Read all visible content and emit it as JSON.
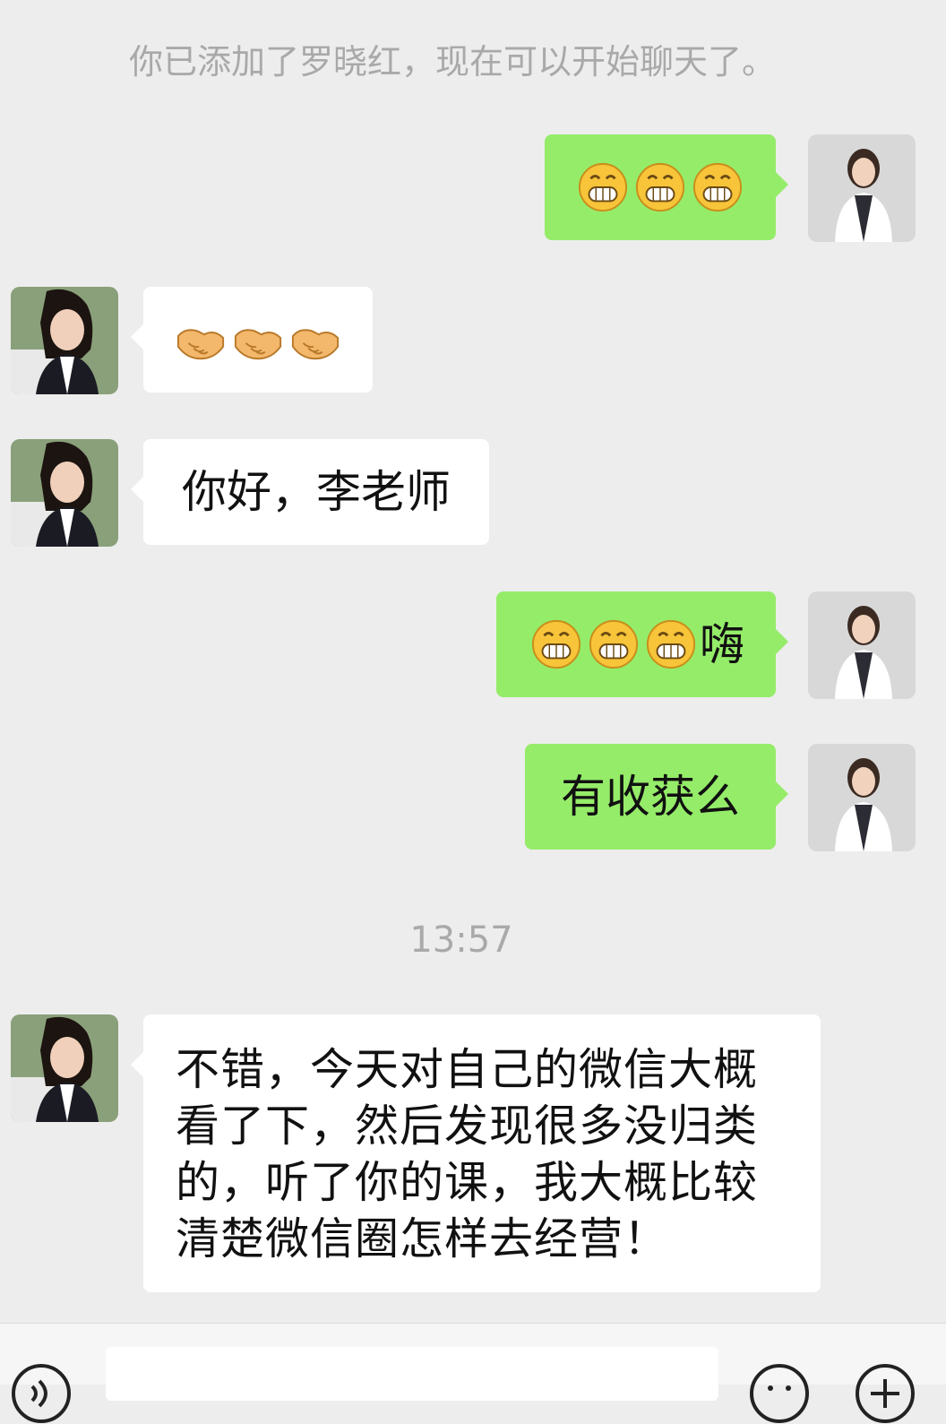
{
  "system_note": "你已添加了罗晓红，现在可以开始聊天了。",
  "timestamp": "13:57",
  "messages": [
    {
      "side": "right",
      "emojis": [
        "grin-emoji",
        "grin-emoji",
        "grin-emoji"
      ],
      "text": ""
    },
    {
      "side": "left",
      "emojis": [
        "handshake-emoji",
        "handshake-emoji",
        "handshake-emoji"
      ],
      "text": ""
    },
    {
      "side": "left",
      "emojis": [],
      "text": "你好，李老师"
    },
    {
      "side": "right",
      "emojis": [
        "grin-emoji",
        "grin-emoji",
        "grin-emoji"
      ],
      "text": "嗨"
    },
    {
      "side": "right",
      "emojis": [],
      "text": "有收获么"
    },
    {
      "side": "left",
      "emojis": [],
      "text": "不错，今天对自己的微信大概看了下，然后发现很多没归类的，听了你的课，我大概比较清楚微信圈怎样去经营！"
    }
  ],
  "long_message_lines": [
    "不错，今天对自己的微信大概",
    "看了下，然后发现很多没归类",
    "的，听了你的课，我大概比较",
    "清楚微信圈怎样去经营！"
  ],
  "colors": {
    "background": "#ededed",
    "self_bubble": "#95ec69",
    "other_bubble": "#ffffff",
    "system_text": "#a9a9a9"
  },
  "input_bar": {
    "left_icon": "voice-icon",
    "right_icons": [
      "emoji-icon",
      "plus-icon"
    ]
  }
}
